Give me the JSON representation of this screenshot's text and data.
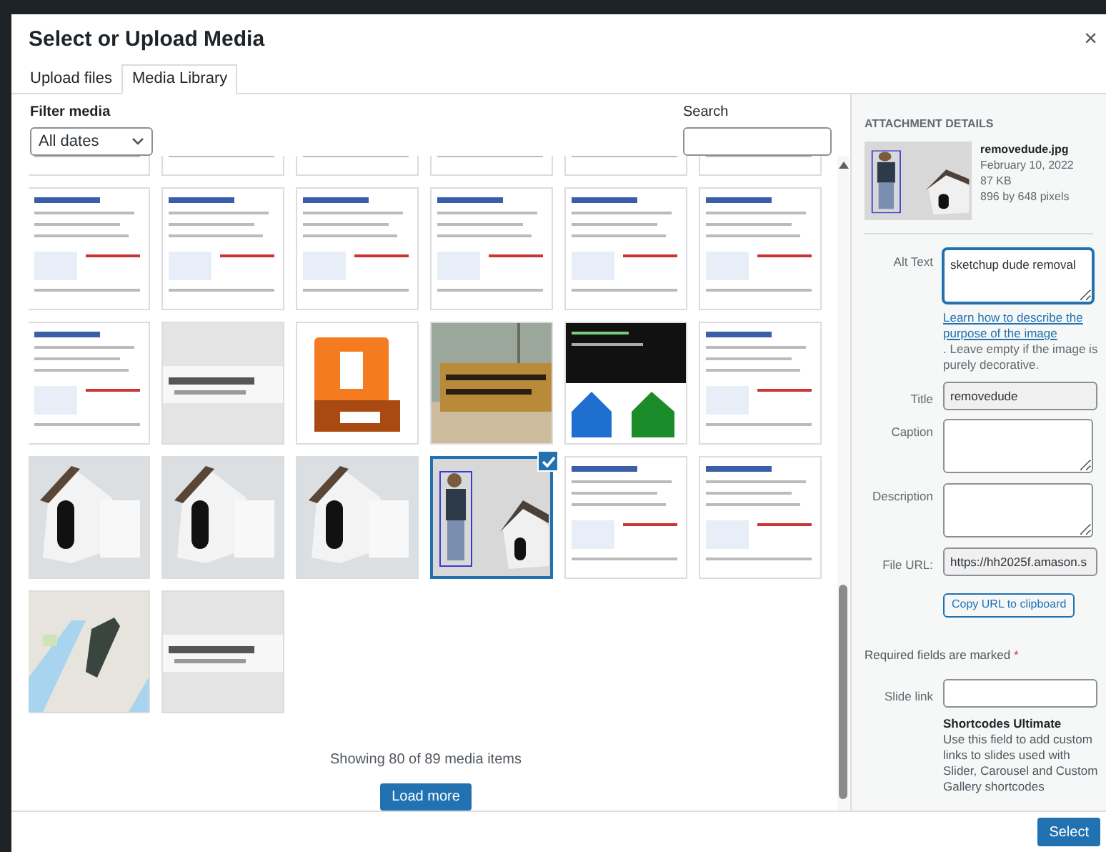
{
  "window": {
    "title": "Select or Upload Media",
    "close": "×"
  },
  "tabs": [
    {
      "label": "Upload files",
      "selected": false
    },
    {
      "label": "Media Library",
      "selected": true
    }
  ],
  "filter": {
    "label": "Filter media",
    "value": "All dates"
  },
  "search": {
    "label": "Search"
  },
  "media_items": [
    {
      "kind": "picture",
      "selected": false
    },
    {
      "kind": "picture",
      "selected": false
    },
    {
      "kind": "picture",
      "selected": false
    },
    {
      "kind": "picture",
      "selected": false
    },
    {
      "kind": "picture",
      "selected": false
    },
    {
      "kind": "picture",
      "selected": false
    },
    {
      "kind": "picture",
      "selected": false
    },
    {
      "kind": "picture",
      "selected": false
    },
    {
      "kind": "picture",
      "selected": false
    },
    {
      "kind": "picture",
      "selected": false
    },
    {
      "kind": "picture",
      "selected": false
    },
    {
      "kind": "picture",
      "selected": false
    },
    {
      "kind": "picture",
      "selected": false
    },
    {
      "kind": "picture",
      "selected": false
    },
    {
      "kind": "picture",
      "selected": false
    },
    {
      "kind": "picture",
      "selected": false
    },
    {
      "kind": "picture",
      "selected": false
    },
    {
      "kind": "picture",
      "selected": false
    },
    {
      "kind": "picture",
      "selected": false
    },
    {
      "kind": "picture",
      "selected": false
    },
    {
      "kind": "picture",
      "selected": false
    },
    {
      "kind": "picture",
      "selected": true
    },
    {
      "kind": "picture",
      "selected": false
    },
    {
      "kind": "picture",
      "selected": false
    },
    {
      "kind": "picture",
      "selected": false
    },
    {
      "kind": "picture",
      "selected": false
    }
  ],
  "footer": {
    "count": "Showing 80 of 89 media items",
    "load_more": "Load more"
  },
  "details": {
    "heading": "ATTACHMENT DETAILS",
    "file_name": "removedude.jpg",
    "date": "February 10, 2022",
    "size": "87 KB",
    "dimensions": "896 by 648 pixels",
    "fields": [
      {
        "kind": "textarea",
        "label": "Alt Text",
        "value": "sketchup dude removal",
        "focused": true,
        "readonly": false
      },
      {
        "kind": "help",
        "link": "Learn how to describe the purpose of the image",
        "text": ". Leave empty if the image is purely decorative."
      },
      {
        "kind": "input",
        "label": "Title",
        "value": "removedude",
        "focused": false,
        "readonly": true
      },
      {
        "kind": "textarea",
        "label": "Caption",
        "focused": false,
        "readonly": false
      },
      {
        "kind": "textarea",
        "label": "Description",
        "focused": false,
        "readonly": false
      },
      {
        "kind": "input",
        "label": "File URL:",
        "value": "https://hh2025f.amason.s",
        "focused": false,
        "readonly": true
      },
      {
        "kind": "button",
        "label": "Copy URL to clipboard"
      },
      {
        "kind": "note",
        "text": "Required fields are marked",
        "mark": "*"
      },
      {
        "kind": "input",
        "label": "Slide link",
        "focused": false,
        "readonly": false
      },
      {
        "kind": "info",
        "title": "Shortcodes Ultimate",
        "text": "Use this field to add custom links to slides used with Slider, Carousel and Custom Gallery shortcodes"
      }
    ]
  },
  "select_button": "Select"
}
